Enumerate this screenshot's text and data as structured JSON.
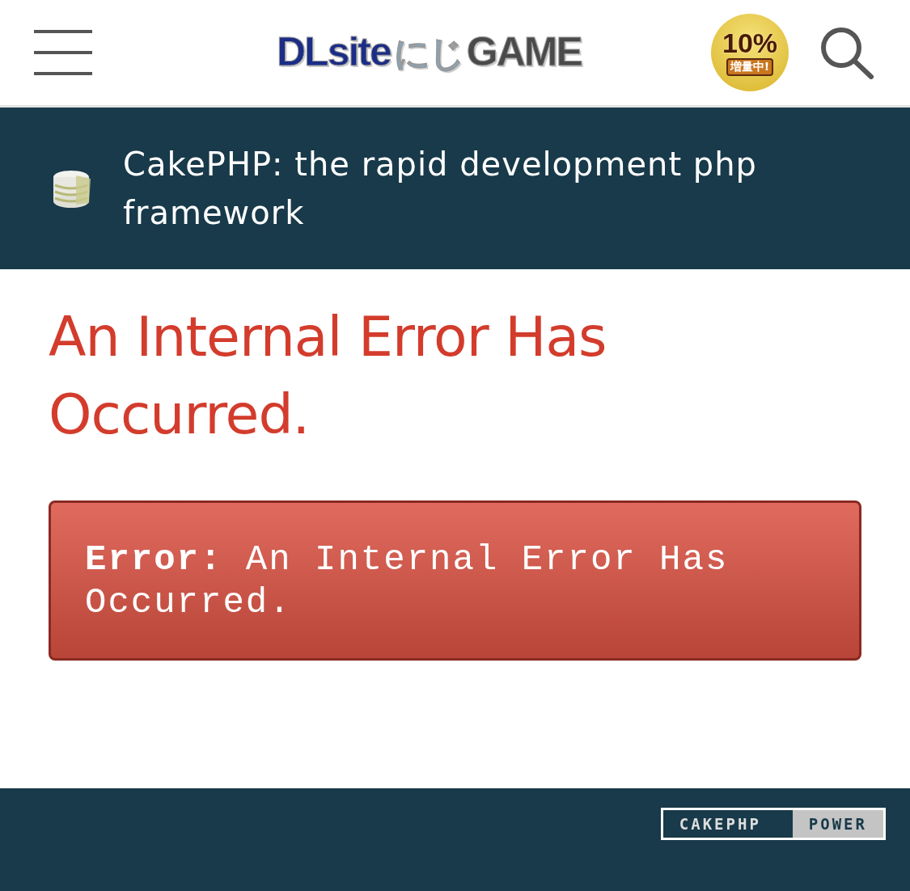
{
  "header": {
    "logo": [
      "DLsite",
      "にじ",
      "GAME"
    ],
    "badge": {
      "value": "10%",
      "caption": "増量中!"
    }
  },
  "banner": {
    "title": "CakePHP: the rapid development php framework"
  },
  "heading": "An Internal Error Has Occurred.",
  "error": {
    "label": "Error:",
    "message": "An Internal Error Has Occurred."
  },
  "footer": {
    "power_badge": [
      "CAKEPHP",
      "POWER"
    ]
  }
}
